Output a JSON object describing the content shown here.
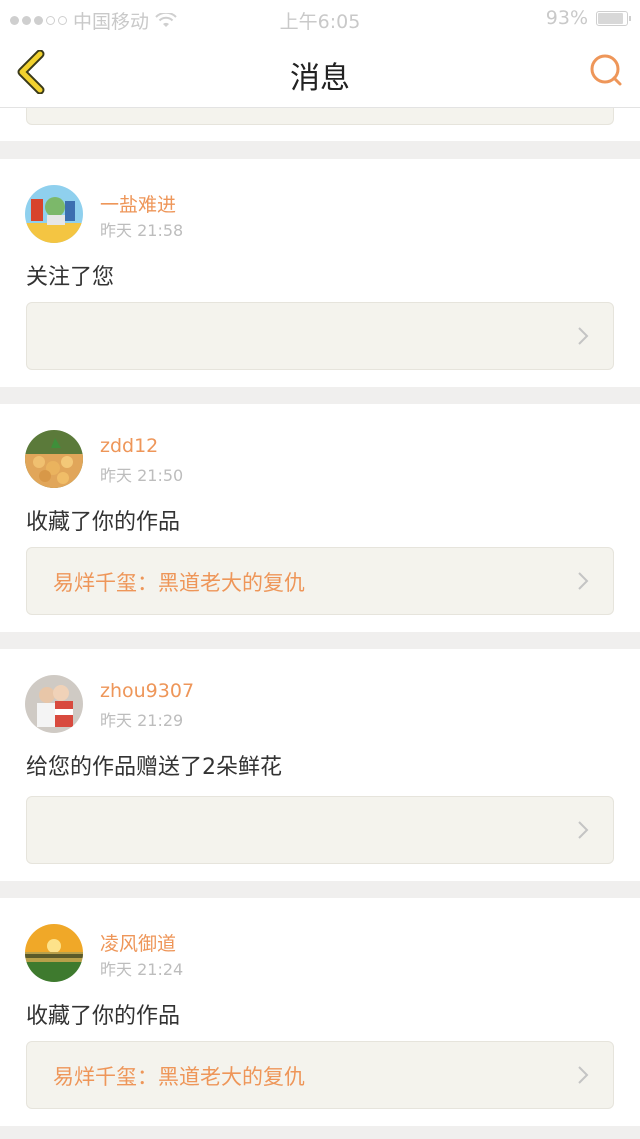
{
  "status_bar": {
    "carrier": "中国移动",
    "time": "上午6:05",
    "battery": "93%"
  },
  "nav": {
    "title": "消息",
    "back_icon": "chevron-left-icon",
    "search_icon": "search-icon"
  },
  "colors": {
    "accent": "#ee9659",
    "back_arrow": "#f2d22e",
    "card_ref_bg": "#f4f3ed",
    "page_bg": "#f0efee"
  },
  "messages": [
    {
      "username": "一盐难进",
      "time": "昨天 21:58",
      "action": "关注了您",
      "ref_title": ""
    },
    {
      "username": "zdd12",
      "time": "昨天 21:50",
      "action": "收藏了你的作品",
      "ref_title": "易烊千玺：黑道老大的复仇"
    },
    {
      "username": "zhou9307",
      "time": "昨天 21:29",
      "action": "给您的作品赠送了2朵鲜花",
      "ref_title": ""
    },
    {
      "username": "凌风御道",
      "time": "昨天 21:24",
      "action": "收藏了你的作品",
      "ref_title": "易烊千玺：黑道老大的复仇"
    }
  ]
}
